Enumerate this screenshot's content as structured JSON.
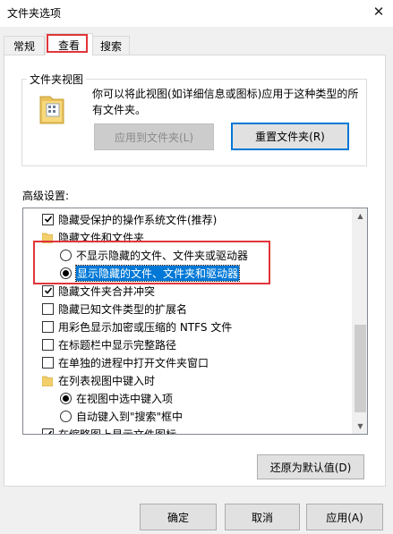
{
  "window": {
    "title": "文件夹选项",
    "close_glyph": "✕"
  },
  "tabs": [
    {
      "label": "常规",
      "selected": false
    },
    {
      "label": "查看",
      "selected": true
    },
    {
      "label": "搜索",
      "selected": false
    }
  ],
  "folder_view": {
    "group_label": "文件夹视图",
    "description": "你可以将此视图(如详细信息或图标)应用于这种类型的所有文件夹。",
    "apply_button": "应用到文件夹(L)",
    "reset_button": "重置文件夹(R)"
  },
  "advanced": {
    "label": "高级设置:",
    "items": [
      {
        "kind": "checkbox",
        "checked": true,
        "label": "隐藏受保护的操作系统文件(推荐)"
      },
      {
        "kind": "folder",
        "label": "隐藏文件和文件夹"
      },
      {
        "kind": "radio",
        "checked": false,
        "label": "不显示隐藏的文件、文件夹或驱动器"
      },
      {
        "kind": "radio",
        "checked": true,
        "label": "显示隐藏的文件、文件夹和驱动器",
        "selected": true
      },
      {
        "kind": "checkbox",
        "checked": true,
        "label": "隐藏文件夹合并冲突"
      },
      {
        "kind": "checkbox",
        "checked": false,
        "label": "隐藏已知文件类型的扩展名"
      },
      {
        "kind": "checkbox",
        "checked": false,
        "label": "用彩色显示加密或压缩的 NTFS 文件"
      },
      {
        "kind": "checkbox",
        "checked": false,
        "label": "在标题栏中显示完整路径"
      },
      {
        "kind": "checkbox",
        "checked": false,
        "label": "在单独的进程中打开文件夹窗口"
      },
      {
        "kind": "folder",
        "label": "在列表视图中键入时"
      },
      {
        "kind": "radio",
        "checked": true,
        "label": "在视图中选中键入项"
      },
      {
        "kind": "radio",
        "checked": false,
        "label": "自动键入到\"搜索\"框中"
      },
      {
        "kind": "checkbox",
        "checked": true,
        "label": "在缩略图上显示文件图标"
      }
    ],
    "restore_button": "还原为默认值(D)"
  },
  "footer": {
    "ok": "确定",
    "cancel": "取消",
    "apply": "应用(A)"
  },
  "colors": {
    "highlight": "#e0353a",
    "selection": "#0078d7",
    "default_button_border": "#0078d7"
  }
}
